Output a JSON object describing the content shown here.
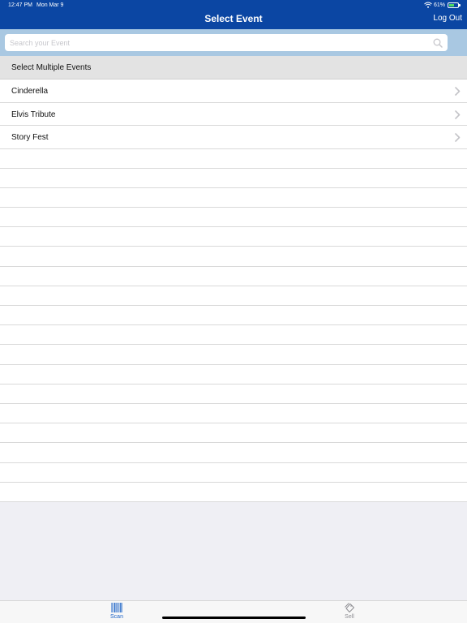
{
  "status_bar": {
    "time": "12:47 PM",
    "date": "Mon Mar 9",
    "battery": "61%",
    "battery_level": 0.61
  },
  "nav": {
    "title": "Select Event",
    "logout_label": "Log Out"
  },
  "search": {
    "placeholder": "Search your Event",
    "value": ""
  },
  "list": {
    "select_multiple_label": "Select Multiple Events",
    "events": [
      {
        "label": "Cinderella"
      },
      {
        "label": "Elvis Tribute"
      },
      {
        "label": "Story Fest"
      }
    ]
  },
  "tab_bar": {
    "tabs": [
      {
        "label": "Scan",
        "icon": "barcode-icon",
        "selected": true
      },
      {
        "label": "Sell",
        "icon": "ticket-icon",
        "selected": false
      }
    ]
  },
  "colors": {
    "nav_bar": "#0b46a3",
    "search_band": "#a9c8e2",
    "tab_selected": "#1c63c7",
    "tab_unselected": "#8e8e93"
  }
}
